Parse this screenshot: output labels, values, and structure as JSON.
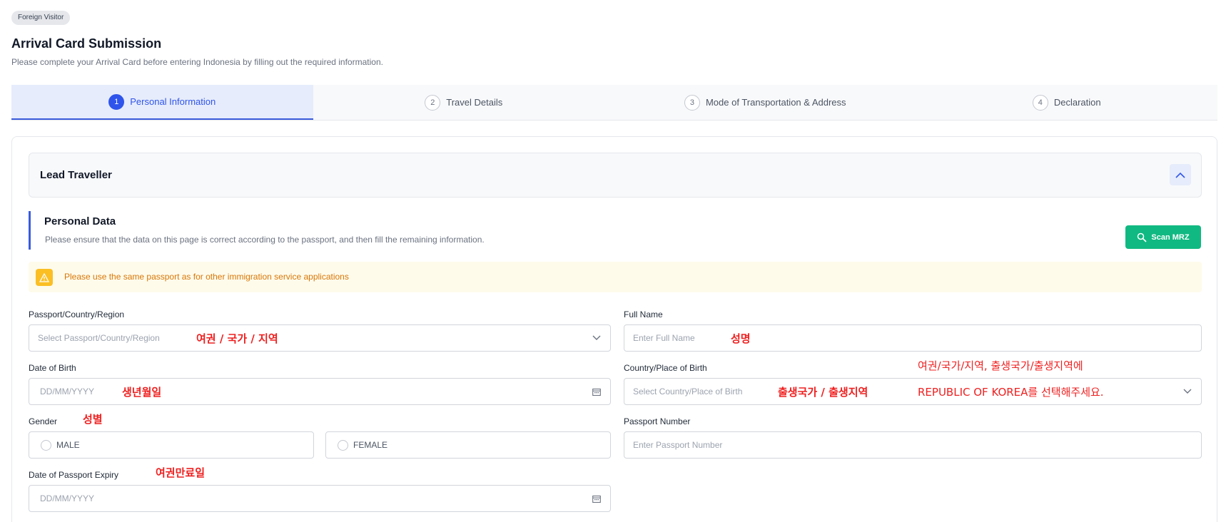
{
  "header": {
    "badge": "Foreign Visitor",
    "title": "Arrival Card Submission",
    "subtitle": "Please complete your Arrival Card before entering Indonesia by filling out the required information."
  },
  "steps": [
    {
      "num": "1",
      "label": "Personal Information",
      "active": true
    },
    {
      "num": "2",
      "label": "Travel Details",
      "active": false
    },
    {
      "num": "3",
      "label": "Mode of Transportation & Address",
      "active": false
    },
    {
      "num": "4",
      "label": "Declaration",
      "active": false
    }
  ],
  "lead": {
    "title": "Lead Traveller"
  },
  "personal": {
    "title": "Personal Data",
    "description": "Please ensure that the data on this page is correct according to the passport, and then fill the remaining information.",
    "scan_label": "Scan MRZ"
  },
  "alert": {
    "text": "Please use the same passport as for other immigration service applications"
  },
  "form": {
    "passport_country": {
      "label": "Passport/Country/Region",
      "placeholder": "Select Passport/Country/Region"
    },
    "full_name": {
      "label": "Full Name",
      "placeholder": "Enter Full Name"
    },
    "dob": {
      "label": "Date of Birth",
      "placeholder": "DD/MM/YYYY"
    },
    "birth_place": {
      "label": "Country/Place of Birth",
      "placeholder": "Select Country/Place of Birth"
    },
    "gender": {
      "label": "Gender",
      "male": "MALE",
      "female": "FEMALE"
    },
    "passport_number": {
      "label": "Passport Number",
      "placeholder": "Enter Passport Number"
    },
    "passport_expiry": {
      "label": "Date of Passport Expiry",
      "placeholder": "DD/MM/YYYY"
    }
  },
  "annotations": {
    "passport_country": "여권 / 국가 / 지역",
    "full_name": "성명",
    "dob": "생년월일",
    "birth_place": "출생국가 / 출생지역",
    "note_line1": "여권/국가/지역, 출생국가/출생지역에",
    "note_line2": "REPUBLIC OF KOREA를 선택해주세요.",
    "gender": "성별",
    "passport_expiry": "여권만료일"
  },
  "colors": {
    "primary": "#2f54eb",
    "scan_button": "#10b981",
    "alert_bg": "#fefbeb",
    "alert_text": "#d97706",
    "annotation": "#ef2020"
  }
}
